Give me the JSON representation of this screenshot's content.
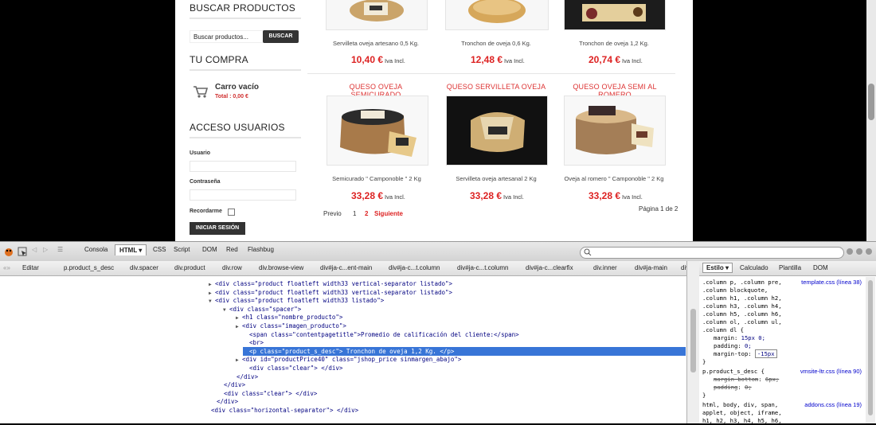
{
  "sidebar": {
    "search_heading": "BUSCAR PRODUCTOS",
    "search_placeholder": "Buscar productos...",
    "search_button": "BUSCAR",
    "cart_heading": "TU COMPRA",
    "cart_empty": "Carro vacío",
    "cart_total": "Total : 0,00 €",
    "login_heading": "ACCESO USUARIOS",
    "user_label": "Usuario",
    "password_label": "Contraseña",
    "remember_label": "Recordarme",
    "login_button": "INICIAR SESIÓN"
  },
  "products_top": [
    {
      "name": "Servilleta oveja artesano 0,5 Kg.",
      "price": "10,40 €",
      "tax": "Iva Incl."
    },
    {
      "name": "Tronchon de oveja 0,6 Kg.",
      "price": "12,48 €",
      "tax": "Iva Incl."
    },
    {
      "name": "Tronchon de oveja 1,2 Kg.",
      "price": "20,74 €",
      "tax": "Iva Incl."
    }
  ],
  "products_bottom": [
    {
      "title": "QUESO OVEJA SEMICURADO",
      "name": "Semicurado \" Camponoble \" 2 Kg",
      "price": "33,28 €",
      "tax": "Iva Incl."
    },
    {
      "title": "QUESO SERVILLETA OVEJA",
      "name": "Servilleta oveja artesanal 2 Kg",
      "price": "33,28 €",
      "tax": "Iva Incl."
    },
    {
      "title": "QUESO OVEJA SEMI AL ROMERO",
      "name": "Oveja al romero \" Camponoble \" 2 Kg",
      "price": "33,28 €",
      "tax": "Iva Incl."
    }
  ],
  "pagination": {
    "prev": "Previo",
    "p1": "1",
    "p2": "2",
    "next": "Siguiente",
    "info": "Página 1 de 2"
  },
  "firebug": {
    "tabs": [
      "Consola",
      "HTML",
      "CSS",
      "Script",
      "DOM",
      "Red",
      "Flashbug"
    ],
    "edit": "Editar",
    "breadcrumbs": [
      "p.product_s_desc",
      "div.spacer",
      "div.product",
      "div.row",
      "div.browse-view",
      "div#ja-c...ent-main",
      "div#ja-c...t.column",
      "div#ja-c...t.column",
      "div#ja-c...clearfix",
      "div.inner",
      "div#ja-main",
      "div"
    ],
    "style_tabs": [
      "Estilo",
      "Calculado",
      "Plantilla",
      "DOM"
    ],
    "html_lines": [
      {
        "indent": 262,
        "tw": "▶",
        "text": "<div class=\"product floatleft width33 vertical-separator listado\">"
      },
      {
        "indent": 262,
        "tw": "▶",
        "text": "<div class=\"product floatleft width33 vertical-separator listado\">"
      },
      {
        "indent": 262,
        "tw": "▼",
        "text": "<div class=\"product floatleft width33 listado\">"
      },
      {
        "indent": 280,
        "tw": "▼",
        "text": "<div class=\"spacer\">"
      },
      {
        "indent": 296,
        "tw": "▶",
        "text": "<h1 class=\"nombre_producto\">"
      },
      {
        "indent": 296,
        "tw": "▶",
        "text": "<div class=\"imagen_producto\">"
      },
      {
        "indent": 305,
        "tw": "",
        "text": "<span class=\"contentpagetitle\">Promedio de calificación del cliente:</span>"
      },
      {
        "indent": 305,
        "tw": "",
        "text": "<br>"
      },
      {
        "indent": 305,
        "tw": "",
        "text": "<p class=\"product_s_desc\"> Tronchon de oveja 1,2 Kg. </p>"
      },
      {
        "indent": 296,
        "tw": "▶",
        "text": "<div id=\"productPrice40\" class=\"jshop_price sinmargen_abajo\">"
      },
      {
        "indent": 305,
        "tw": "",
        "text": "<div class=\"clear\"> </div>"
      },
      {
        "indent": 289,
        "tw": "",
        "text": "</div>"
      },
      {
        "indent": 273,
        "tw": "",
        "text": "</div>"
      },
      {
        "indent": 273,
        "tw": "",
        "text": "<div class=\"clear\"> </div>"
      },
      {
        "indent": 264,
        "tw": "",
        "text": "</div>"
      },
      {
        "indent": 257,
        "tw": "",
        "text": "<div class=\"horizontal-separator\"> </div>"
      }
    ],
    "css_rule1_selectors": [
      ".column p, .column pre,",
      ".column blockquote,",
      ".column h1, .column h2,",
      ".column h3, .column h4,",
      ".column h5, .column h6,",
      ".column ol, .column ul,",
      ".column dl {"
    ],
    "css_rule1_src": "template.css (línea 38)",
    "css_rule1_props": [
      {
        "p": "margin",
        "v": "15px 0;"
      },
      {
        "p": "padding",
        "v": "0;"
      },
      {
        "p": "margin-top",
        "v": "-15px"
      }
    ],
    "css_rule2_selector": "p.product_s_desc {",
    "css_rule2_src": "vmsite-ltr.css (línea 90)",
    "css_rule2_props": [
      {
        "p": "margin-bottom",
        "v": "6px;"
      },
      {
        "p": "padding",
        "v": "0;"
      }
    ],
    "css_rule3_selectors": [
      "html, body, div, span,",
      "applet, object, iframe,",
      "h1, h2, h3, h4, h5, h6,"
    ],
    "css_rule3_src": "addons.css (línea 19)",
    "brace": "}"
  }
}
